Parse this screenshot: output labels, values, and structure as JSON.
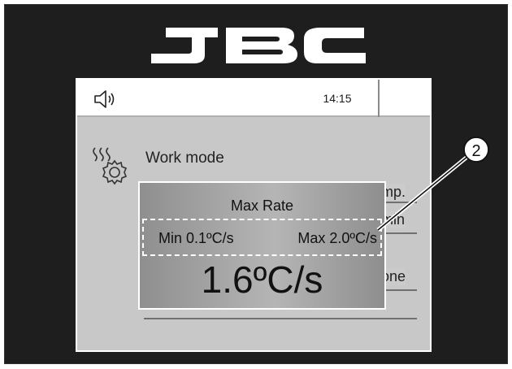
{
  "brand": {
    "logo_text": "JBC"
  },
  "status_bar": {
    "time": "14:15",
    "sound_icon": "speaker-icon"
  },
  "screen": {
    "title": "Work mode",
    "menu_fragments": [
      "mp.",
      "min",
      "one"
    ]
  },
  "popup": {
    "title": "Max Rate",
    "min_label": "Min 0.1ºC/s",
    "max_label": "Max 2.0ºC/s",
    "value": "1.6ºC/s"
  },
  "callout": {
    "number": "2"
  },
  "colors": {
    "frame": "#1e1e1e",
    "screen_bg": "#c8c8c8",
    "popup_bg": "#a8a8a8"
  }
}
